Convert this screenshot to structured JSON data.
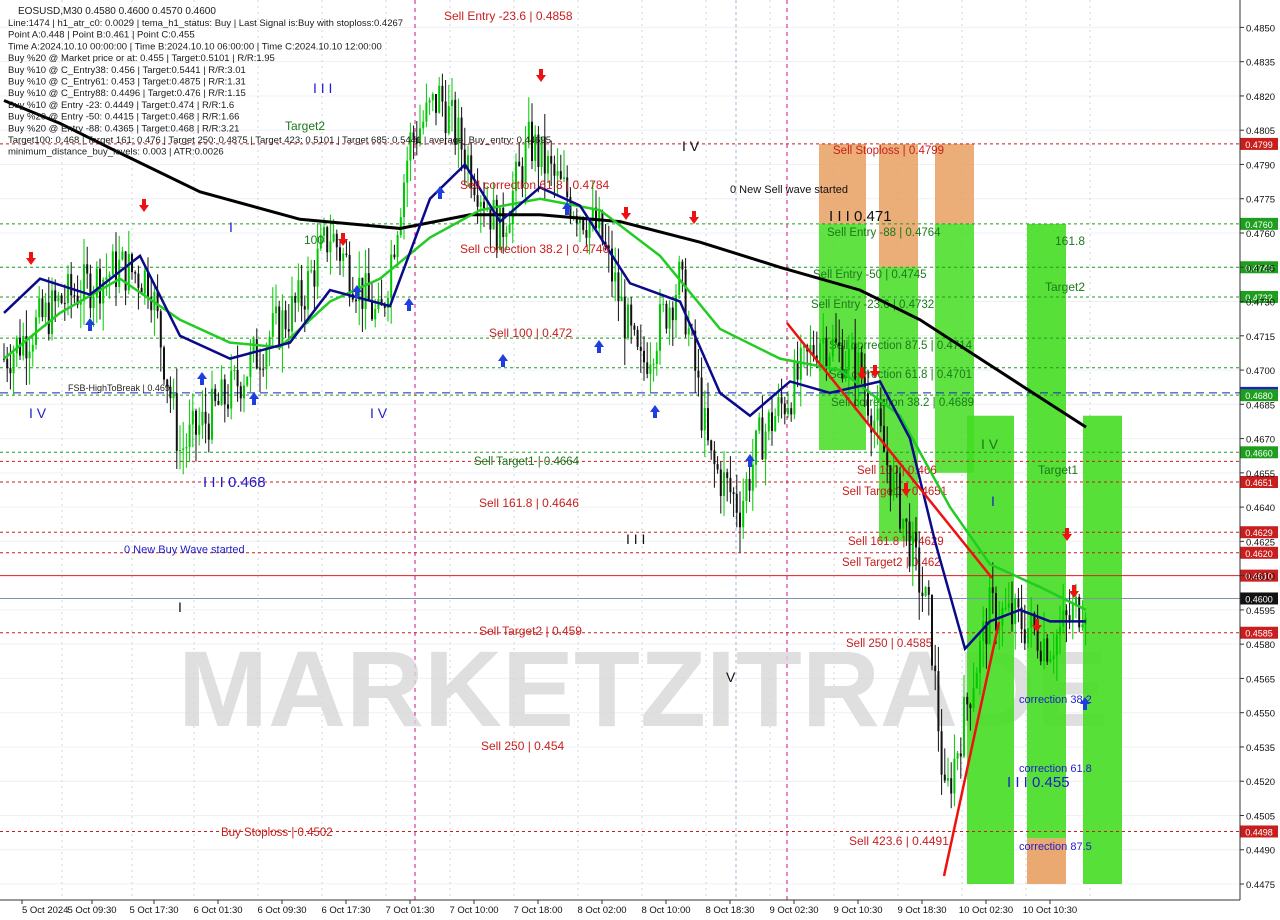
{
  "header": {
    "symbol_line": "EOSUSD,M30  0.4580 0.4600 0.4570 0.4600",
    "info_lines": [
      "Line:1474  |  h1_atr_c0: 0.0029  |  tema_h1_status: Buy  |  Last Signal is:Buy with stoploss:0.4267",
      "Point A:0.448  |  Point B:0.461  |  Point C:0.455",
      "Time A:2024.10.10 00:00:00  |  Time B:2024.10.10 06:00:00  |  Time C:2024.10.10 12:00:00",
      "Buy %20 @ Market price or at: 0.455  |  Target:0.5101  |  R/R:1.95",
      "Buy %10 @ C_Entry38: 0.456  |  Target:0.5441  |  R/R:3.01",
      "Buy %10 @ C_Entry61: 0.453  |  Target:0.4875  |  R/R:1.31",
      "Buy %10 @ C_Entry88: 0.4496  |  Target:0.476  |  R/R:1.15",
      "Buy %10 @ Entry -23: 0.4449  |  Target:0.474  |  R/R:1.6",
      "Buy %20 @ Entry -50: 0.4415  |  Target:0.468  |  R/R:1.66",
      "Buy %20 @ Entry -88: 0.4365  |  Target:0.468  |  R/R:3.21",
      "Target100: 0.468  |  Target 161: 0.476  |  Target 250: 0.4875  |  Target 423: 0.5101  |  Target 685: 0.5441  |  average_Buy_entry: 0.44695",
      "minimum_distance_buy_levels: 0.003  |  ATR:0.0026"
    ]
  },
  "watermark": "MARKETZITRADE",
  "colors": {
    "background": "#ffffff",
    "grid": "#c0c8d4",
    "bull_candle": "#00c800",
    "bear_candle": "#111111",
    "ma_slow": "#000000",
    "ma_mid": "#22cc22",
    "ma_fast": "#0a0a8a",
    "sell_level": "#c81e1e",
    "buy_level": "#1e9e1e",
    "blue_level": "#1e1ecc",
    "zone_green": "#44dd22",
    "zone_orange": "#e8a060",
    "axis_text": "#111111"
  },
  "chart_data": {
    "type": "candlestick",
    "symbol": "EOSUSD",
    "timeframe": "M30",
    "ohlc_last": {
      "open": 0.458,
      "high": 0.46,
      "low": 0.457,
      "close": 0.46
    },
    "y_range": [
      0.4468,
      0.4862
    ],
    "y_ticks": [
      "0.4850",
      "0.4835",
      "0.4820",
      "0.4805",
      "0.4790",
      "0.4775",
      "0.4760",
      "0.4745",
      "0.4730",
      "0.4715",
      "0.4700",
      "0.4685",
      "0.4670",
      "0.4655",
      "0.4640",
      "0.4625",
      "0.4610",
      "0.4595",
      "0.4580",
      "0.4565",
      "0.4550",
      "0.4535",
      "0.4520",
      "0.4505",
      "0.4490",
      "0.4475"
    ],
    "x_labels": [
      "5 Oct 2024",
      "5 Oct 09:30",
      "5 Oct 17:30",
      "6 Oct 01:30",
      "6 Oct 09:30",
      "6 Oct 17:30",
      "7 Oct 01:30",
      "7 Oct 10:00",
      "7 Oct 18:00",
      "8 Oct 02:00",
      "8 Oct 10:00",
      "8 Oct 18:30",
      "9 Oct 02:30",
      "9 Oct 10:30",
      "9 Oct 18:30",
      "10 Oct 02:30",
      "10 Oct 10:30"
    ],
    "price_levels": [
      {
        "label": "Sell Stoploss | 0.4799",
        "value": 0.4799,
        "kind": "sell",
        "tag": "0.4799"
      },
      {
        "label": "Sell Entry -88 | 0.4764",
        "value": 0.4764,
        "kind": "buy",
        "tag": "0.4760"
      },
      {
        "label": "Sell Entry -50 | 0.4745",
        "value": 0.4745,
        "kind": "buy",
        "tag": "0.4740"
      },
      {
        "label": "Sell Entry -23.6 | 0.4732",
        "value": 0.4732,
        "kind": "buy",
        "tag": "0.4732"
      },
      {
        "label": "Sell correction 87.5 | 0.4714",
        "value": 0.4714,
        "kind": "buy",
        "tag": ""
      },
      {
        "label": "Sell correction 61.8 | 0.4701",
        "value": 0.4701,
        "kind": "buy",
        "tag": ""
      },
      {
        "label": "FSB-HighToBreak | 0.469",
        "value": 0.469,
        "kind": "blue",
        "tag": "0.4690"
      },
      {
        "label": "Sell correction 38.2 | 0.4689",
        "value": 0.4689,
        "kind": "buy",
        "tag": "0.4680"
      },
      {
        "label": "Sell Target1 | 0.4664",
        "value": 0.4664,
        "kind": "buy",
        "tag": "0.4660"
      },
      {
        "label": "Sell 100 | 0.466",
        "value": 0.466,
        "kind": "sell",
        "tag": ""
      },
      {
        "label": "Sell Target1 | 0.4651",
        "value": 0.4651,
        "kind": "sell",
        "tag": "0.4651"
      },
      {
        "label": "Sell 161.8 | 0.4629",
        "value": 0.4629,
        "kind": "sell",
        "tag": "0.4629"
      },
      {
        "label": "Sell Target2 | 0.462",
        "value": 0.462,
        "kind": "sell",
        "tag": "0.4620"
      },
      {
        "label": "",
        "value": 0.461,
        "kind": "solid-red",
        "tag": "0.4610"
      },
      {
        "label": "",
        "value": 0.46,
        "kind": "blue-solid",
        "tag": "0.4600"
      },
      {
        "label": "Sell 250 | 0.4585",
        "value": 0.4585,
        "kind": "sell",
        "tag": "0.4585"
      },
      {
        "label": "Buy Stoploss | 0.4502",
        "value": 0.4498,
        "kind": "sell",
        "tag": "0.4498"
      }
    ],
    "annotations": [
      {
        "text": "Sell Entry -23.6 | 0.4858",
        "kind": "sell-text"
      },
      {
        "text": "Sell correction 61.8 | 0.4784",
        "kind": "sell-text"
      },
      {
        "text": "Sell correction 38.2 | 0.4746",
        "kind": "sell-text"
      },
      {
        "text": "Sell 100 | 0.472",
        "kind": "sell-text"
      },
      {
        "text": "Sell 161.8 | 0.4646",
        "kind": "sell-text"
      },
      {
        "text": "Sell Target2 | 0.459",
        "kind": "sell-text"
      },
      {
        "text": "Sell 250 | 0.454",
        "kind": "sell-text"
      },
      {
        "text": "Sell 423.6 | 0.4491",
        "kind": "sell-text"
      },
      {
        "text": "0 New Sell wave started",
        "kind": "black-text"
      },
      {
        "text": "0 New Buy Wave started",
        "kind": "blue-text"
      },
      {
        "text": "I I I 0.471",
        "kind": "black-text"
      },
      {
        "text": "I I I 0.468",
        "kind": "blue-text"
      },
      {
        "text": "I I I 0.455",
        "kind": "blue-text"
      },
      {
        "text": "correction 38.2",
        "kind": "blue-text"
      },
      {
        "text": "correction 61.8",
        "kind": "blue-text"
      },
      {
        "text": "correction 87.5",
        "kind": "blue-text"
      },
      {
        "text": "161.8",
        "kind": "green-text"
      },
      {
        "text": "Target2",
        "kind": "green-text"
      },
      {
        "text": "Target1",
        "kind": "green-text"
      },
      {
        "text": "Target2",
        "kind": "green-text"
      },
      {
        "text": "100",
        "kind": "green-text"
      },
      {
        "text": "I V",
        "kind": "black-text"
      },
      {
        "text": "I V",
        "kind": "blue-text"
      },
      {
        "text": "I V",
        "kind": "blue-text"
      },
      {
        "text": "I V",
        "kind": "green-text"
      },
      {
        "text": "I I I",
        "kind": "blue-text"
      },
      {
        "text": "I I I",
        "kind": "black-text"
      },
      {
        "text": "I",
        "kind": "blue-text"
      },
      {
        "text": "I",
        "kind": "black-text"
      },
      {
        "text": "V",
        "kind": "black-text"
      },
      {
        "text": "I",
        "kind": "blue-text"
      }
    ],
    "zones": [
      {
        "from": "9 Oct 02:30",
        "to": "9 Oct 10:30",
        "low": 0.4665,
        "high": 0.4799,
        "color": "orange-green"
      },
      {
        "from": "9 Oct 10:30",
        "to": "9 Oct 18:30",
        "low": 0.4625,
        "high": 0.4799,
        "color": "orange-green"
      },
      {
        "from": "9 Oct 18:30",
        "to": "10 Oct 02:30",
        "low": 0.4655,
        "high": 0.4799,
        "color": "orange-green"
      },
      {
        "from": "10 Oct 02:30",
        "to": "10 Oct 10:30",
        "low": 0.4475,
        "high": 0.468,
        "color": "green"
      },
      {
        "from": "10 Oct 10:30",
        "to": "10 Oct 18:30",
        "low": 0.4475,
        "high": 0.4764,
        "color": "green-orange"
      },
      {
        "from": "10 Oct 18:30",
        "to": "10 Oct 20:30",
        "low": 0.4475,
        "high": 0.468,
        "color": "green"
      }
    ]
  }
}
